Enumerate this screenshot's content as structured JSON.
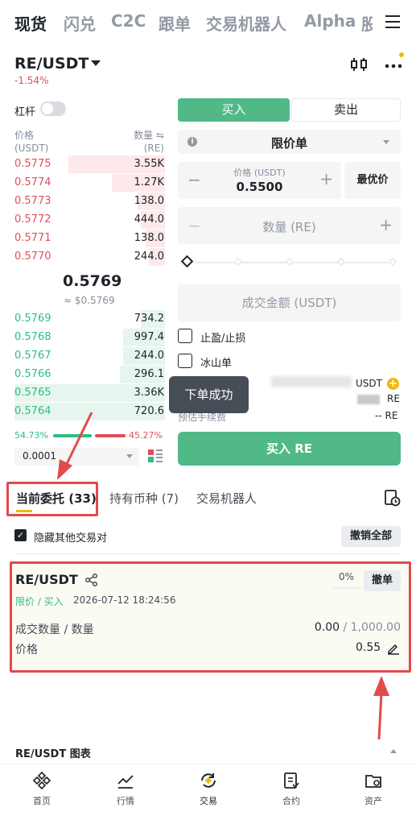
{
  "top_tabs": [
    "现货",
    "闪兑",
    "C2C",
    "跟单",
    "交易机器人",
    "Alpha",
    "股"
  ],
  "pair": {
    "name": "RE/USDT",
    "change": "-1.54%"
  },
  "leverage_label": "杠杆",
  "orderbook": {
    "price_header": "价格",
    "price_unit": "(USDT)",
    "qty_header": "数量 ⇋",
    "qty_unit": "(RE)",
    "asks": [
      {
        "price": "0.5775",
        "qty": "3.55K"
      },
      {
        "price": "0.5774",
        "qty": "1.27K"
      },
      {
        "price": "0.5773",
        "qty": "138.0"
      },
      {
        "price": "0.5772",
        "qty": "444.0"
      },
      {
        "price": "0.5771",
        "qty": "138.0"
      },
      {
        "price": "0.5770",
        "qty": "244.0"
      }
    ],
    "last_price": "0.5769",
    "last_usd": "≈ $0.5769",
    "bids": [
      {
        "price": "0.5769",
        "qty": "734.2"
      },
      {
        "price": "0.5768",
        "qty": "997.4"
      },
      {
        "price": "0.5767",
        "qty": "244.0"
      },
      {
        "price": "0.5766",
        "qty": "296.1"
      },
      {
        "price": "0.5765",
        "qty": "3.36K"
      },
      {
        "price": "0.5764",
        "qty": "720.6"
      }
    ],
    "buy_ratio": "54.73%",
    "sell_ratio": "45.27%",
    "precision": "0.0001"
  },
  "form": {
    "buy_tab": "买入",
    "sell_tab": "卖出",
    "order_type": "限价单",
    "price_label": "价格 (USDT)",
    "price_value": "0.5500",
    "best_price": "最优价",
    "qty_placeholder": "数量 (RE)",
    "total_placeholder": "成交金额 (USDT)",
    "tp_sl": "止盈/止损",
    "iceberg": "冰山单",
    "avail_currency": "USDT",
    "max_currency": "RE",
    "fee_label": "预估手续费",
    "fee_value": "-- RE",
    "submit": "买入 RE",
    "toast": "下单成功"
  },
  "section_tabs": {
    "open_orders": "当前委托 (33)",
    "holdings": "持有币种 (7)",
    "bots": "交易机器人"
  },
  "hide_others": "隐藏其他交易对",
  "cancel_all": "撤销全部",
  "order": {
    "pair": "RE/USDT",
    "percent": "0%",
    "cancel": "撤单",
    "type": "限价 / 买入",
    "time": "2026-07-12 18:24:56",
    "filled_label": "成交数量 / 数量",
    "filled_value": "0.00",
    "total_value": "/ 1,000.00",
    "price_label": "价格",
    "price_value": "0.55"
  },
  "chart_label": "RE/USDT 图表",
  "bottom_nav": [
    "首页",
    "行情",
    "交易",
    "合约",
    "资产"
  ],
  "colors": {
    "buy": "#51b888",
    "sell": "#e14d5d",
    "accent": "#f0b90b",
    "annotation": "#e24b4b"
  }
}
